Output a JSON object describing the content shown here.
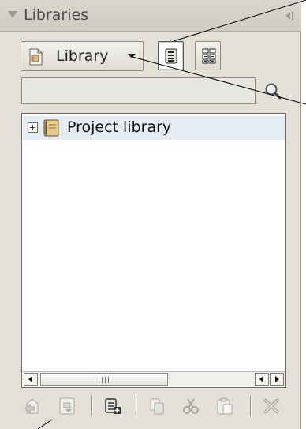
{
  "panel": {
    "title": "Libraries",
    "library_dropdown": {
      "label": "Library"
    },
    "search": {
      "value": "",
      "placeholder": ""
    },
    "tree": {
      "items": [
        {
          "label": "Project library",
          "expanded": false,
          "selected": true
        }
      ]
    },
    "view_buttons": [
      {
        "icon": "list-view-icon",
        "active": true
      },
      {
        "icon": "grid-view-icon",
        "active": false
      }
    ],
    "toolbar": [
      {
        "icon": "import-icon",
        "enabled": false
      },
      {
        "icon": "export-icon",
        "enabled": false
      },
      {
        "icon": "new-library-icon",
        "enabled": true
      },
      {
        "icon": "copy-icon",
        "enabled": false
      },
      {
        "icon": "cut-icon",
        "enabled": false
      },
      {
        "icon": "paste-icon",
        "enabled": false
      },
      {
        "icon": "delete-icon",
        "enabled": false
      }
    ]
  },
  "colors": {
    "panel_bg": "#e3e0d8",
    "tree_selection": "#e6ecf4",
    "border": "#8f8c84"
  }
}
